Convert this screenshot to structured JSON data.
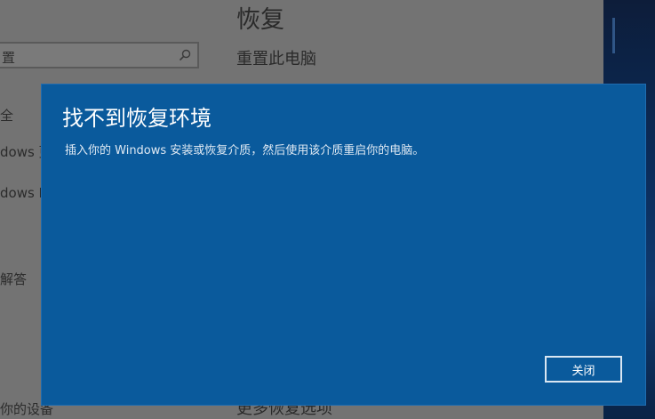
{
  "settings": {
    "page_title": "恢复",
    "section_title": "重置此电脑",
    "bottom_title": "更多恢复选项",
    "search": {
      "value": "置"
    },
    "nav": [
      {
        "label": "全"
      },
      {
        "label": "dows 更"
      },
      {
        "label": "dows D"
      },
      {
        "label": "解答"
      },
      {
        "label": "你的设备"
      }
    ]
  },
  "dialog": {
    "title": "找不到恢复环境",
    "message": "插入你的 Windows 安装或恢复介质，然后使用该介质重启你的电脑。",
    "close_label": "关闭"
  }
}
